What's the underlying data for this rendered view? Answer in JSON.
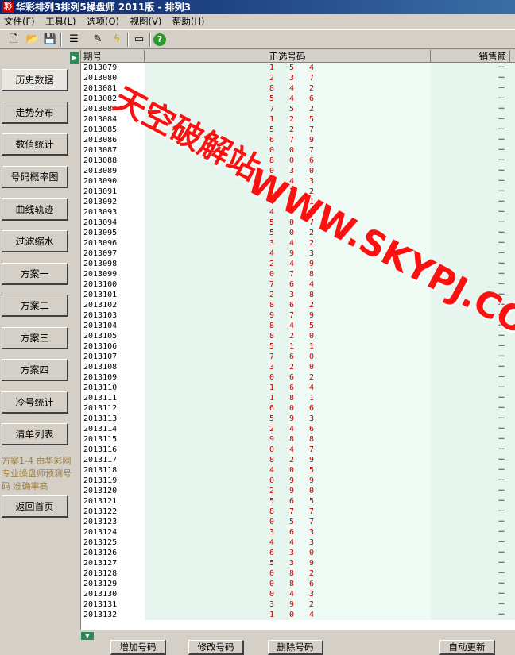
{
  "window": {
    "title": "华彩排列3排列5操盘师 2011版 - 排列3"
  },
  "menu": [
    "文件(F)",
    "工具(L)",
    "选项(O)",
    "视图(V)",
    "帮助(H)"
  ],
  "toolbar_icons": [
    "new-file-icon",
    "open-folder-icon",
    "save-icon",
    "list-icon",
    "wizard-icon",
    "lightning-icon",
    "window-icon",
    "help-icon"
  ],
  "sidebar": {
    "items": [
      "历史数据",
      "走势分布",
      "数值统计",
      "号码概率图",
      "曲线轨迹",
      "过滤缩水",
      "方案一",
      "方案二",
      "方案三",
      "方案四",
      "冷号统计",
      "清单列表"
    ],
    "note": "方案1-4 由华彩网专业操盘师预测号码 准确率高",
    "home_button": "返回首页"
  },
  "grid": {
    "columns": [
      "期号",
      "正选号码",
      "销售额"
    ],
    "rows": [
      [
        "2013079",
        "1",
        "5",
        "4",
        "－"
      ],
      [
        "2013080",
        "2",
        "3",
        "7",
        "－"
      ],
      [
        "2013081",
        "8",
        "4",
        "2",
        "－"
      ],
      [
        "2013082",
        "5",
        "4",
        "6",
        "－"
      ],
      [
        "2013083",
        "7",
        "5",
        "2",
        "－"
      ],
      [
        "2013084",
        "1",
        "2",
        "5",
        "－"
      ],
      [
        "2013085",
        "5",
        "2",
        "7",
        "－"
      ],
      [
        "2013086",
        "6",
        "7",
        "9",
        "－"
      ],
      [
        "2013087",
        "0",
        "0",
        "7",
        "－"
      ],
      [
        "2013088",
        "8",
        "0",
        "6",
        "－"
      ],
      [
        "2013089",
        "0",
        "3",
        "0",
        "－"
      ],
      [
        "2013090",
        "1",
        "4",
        "3",
        "－"
      ],
      [
        "2013091",
        "1",
        "2",
        "2",
        "－"
      ],
      [
        "2013092",
        "6",
        "8",
        "1",
        "－"
      ],
      [
        "2013093",
        "4",
        "7",
        "3",
        "－"
      ],
      [
        "2013094",
        "5",
        "0",
        "7",
        "－"
      ],
      [
        "2013095",
        "5",
        "0",
        "2",
        "－"
      ],
      [
        "2013096",
        "3",
        "4",
        "2",
        "－"
      ],
      [
        "2013097",
        "4",
        "9",
        "3",
        "－"
      ],
      [
        "2013098",
        "2",
        "4",
        "9",
        "－"
      ],
      [
        "2013099",
        "0",
        "7",
        "8",
        "－"
      ],
      [
        "2013100",
        "7",
        "6",
        "4",
        "－"
      ],
      [
        "2013101",
        "2",
        "3",
        "8",
        "－"
      ],
      [
        "2013102",
        "8",
        "6",
        "2",
        "－"
      ],
      [
        "2013103",
        "9",
        "7",
        "9",
        "－"
      ],
      [
        "2013104",
        "8",
        "4",
        "5",
        "－"
      ],
      [
        "2013105",
        "8",
        "2",
        "0",
        "－"
      ],
      [
        "2013106",
        "5",
        "1",
        "1",
        "－"
      ],
      [
        "2013107",
        "7",
        "6",
        "0",
        "－"
      ],
      [
        "2013108",
        "3",
        "2",
        "0",
        "－"
      ],
      [
        "2013109",
        "0",
        "6",
        "2",
        "－"
      ],
      [
        "2013110",
        "1",
        "6",
        "4",
        "－"
      ],
      [
        "2013111",
        "1",
        "8",
        "1",
        "－"
      ],
      [
        "2013112",
        "6",
        "0",
        "6",
        "－"
      ],
      [
        "2013113",
        "5",
        "9",
        "3",
        "－"
      ],
      [
        "2013114",
        "2",
        "4",
        "6",
        "－"
      ],
      [
        "2013115",
        "9",
        "8",
        "8",
        "－"
      ],
      [
        "2013116",
        "0",
        "4",
        "7",
        "－"
      ],
      [
        "2013117",
        "8",
        "2",
        "9",
        "－"
      ],
      [
        "2013118",
        "4",
        "0",
        "5",
        "－"
      ],
      [
        "2013119",
        "0",
        "9",
        "9",
        "－"
      ],
      [
        "2013120",
        "2",
        "9",
        "0",
        "－"
      ],
      [
        "2013121",
        "5",
        "6",
        "5",
        "－"
      ],
      [
        "2013122",
        "8",
        "7",
        "7",
        "－"
      ],
      [
        "2013123",
        "0",
        "5",
        "7",
        "－"
      ],
      [
        "2013124",
        "3",
        "6",
        "3",
        "－"
      ],
      [
        "2013125",
        "4",
        "4",
        "3",
        "－"
      ],
      [
        "2013126",
        "6",
        "3",
        "0",
        "－"
      ],
      [
        "2013127",
        "5",
        "3",
        "9",
        "－"
      ],
      [
        "2013128",
        "0",
        "8",
        "2",
        "－"
      ],
      [
        "2013129",
        "0",
        "8",
        "6",
        "－"
      ],
      [
        "2013130",
        "0",
        "4",
        "3",
        "－"
      ],
      [
        "2013131",
        "3",
        "9",
        "2",
        "－"
      ],
      [
        "2013132",
        "1",
        "0",
        "4",
        "－"
      ]
    ]
  },
  "watermark": {
    "logo": "天空破解站",
    "url": "WWW.SKYPJ.COM"
  },
  "buttons": [
    "增加号码",
    "修改号码",
    "删除号码",
    "自动更新"
  ]
}
